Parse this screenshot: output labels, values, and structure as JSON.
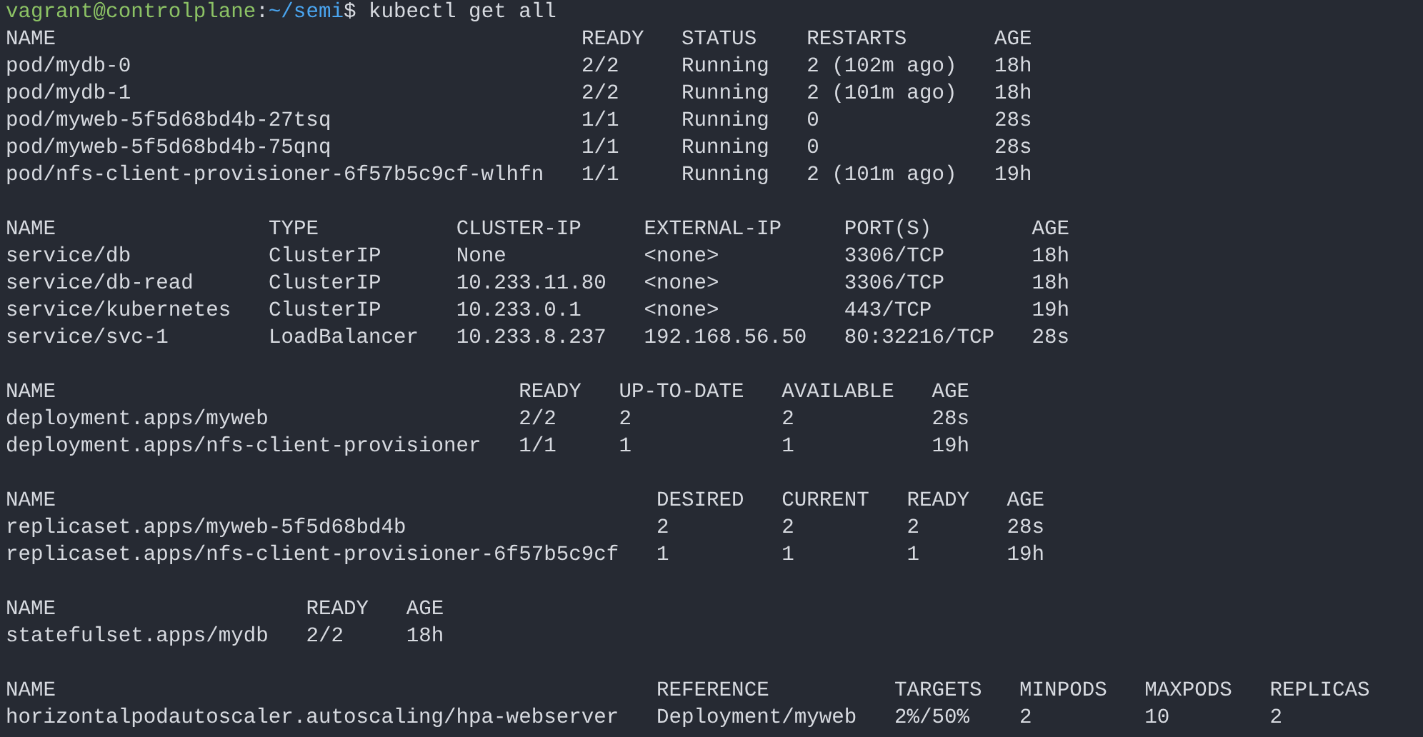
{
  "prompt": {
    "user_host": "vagrant@controlplane",
    "separator": ":",
    "path": "~/semi",
    "symbol": "$",
    "command": "kubectl get all"
  },
  "tables": [
    {
      "columns": [
        "NAME",
        "READY",
        "STATUS",
        "RESTARTS",
        "AGE"
      ],
      "rows": [
        [
          "pod/mydb-0",
          "2/2",
          "Running",
          "2 (102m ago)",
          "18h"
        ],
        [
          "pod/mydb-1",
          "2/2",
          "Running",
          "2 (101m ago)",
          "18h"
        ],
        [
          "pod/myweb-5f5d68bd4b-27tsq",
          "1/1",
          "Running",
          "0",
          "28s"
        ],
        [
          "pod/myweb-5f5d68bd4b-75qnq",
          "1/1",
          "Running",
          "0",
          "28s"
        ],
        [
          "pod/nfs-client-provisioner-6f57b5c9cf-wlhfn",
          "1/1",
          "Running",
          "2 (101m ago)",
          "19h"
        ]
      ]
    },
    {
      "columns": [
        "NAME",
        "TYPE",
        "CLUSTER-IP",
        "EXTERNAL-IP",
        "PORT(S)",
        "AGE"
      ],
      "rows": [
        [
          "service/db",
          "ClusterIP",
          "None",
          "<none>",
          "3306/TCP",
          "18h"
        ],
        [
          "service/db-read",
          "ClusterIP",
          "10.233.11.80",
          "<none>",
          "3306/TCP",
          "18h"
        ],
        [
          "service/kubernetes",
          "ClusterIP",
          "10.233.0.1",
          "<none>",
          "443/TCP",
          "19h"
        ],
        [
          "service/svc-1",
          "LoadBalancer",
          "10.233.8.237",
          "192.168.56.50",
          "80:32216/TCP",
          "28s"
        ]
      ]
    },
    {
      "columns": [
        "NAME",
        "READY",
        "UP-TO-DATE",
        "AVAILABLE",
        "AGE"
      ],
      "rows": [
        [
          "deployment.apps/myweb",
          "2/2",
          "2",
          "2",
          "28s"
        ],
        [
          "deployment.apps/nfs-client-provisioner",
          "1/1",
          "1",
          "1",
          "19h"
        ]
      ]
    },
    {
      "columns": [
        "NAME",
        "DESIRED",
        "CURRENT",
        "READY",
        "AGE"
      ],
      "rows": [
        [
          "replicaset.apps/myweb-5f5d68bd4b",
          "2",
          "2",
          "2",
          "28s"
        ],
        [
          "replicaset.apps/nfs-client-provisioner-6f57b5c9cf",
          "1",
          "1",
          "1",
          "19h"
        ]
      ]
    },
    {
      "columns": [
        "NAME",
        "READY",
        "AGE"
      ],
      "rows": [
        [
          "statefulset.apps/mydb",
          "2/2",
          "18h"
        ]
      ]
    },
    {
      "columns": [
        "NAME",
        "REFERENCE",
        "TARGETS",
        "MINPODS",
        "MAXPODS",
        "REPLICAS"
      ],
      "rows": [
        [
          "horizontalpodautoscaler.autoscaling/hpa-webserver",
          "Deployment/myweb",
          "2%/50%",
          "2",
          "10",
          "2"
        ]
      ]
    }
  ]
}
